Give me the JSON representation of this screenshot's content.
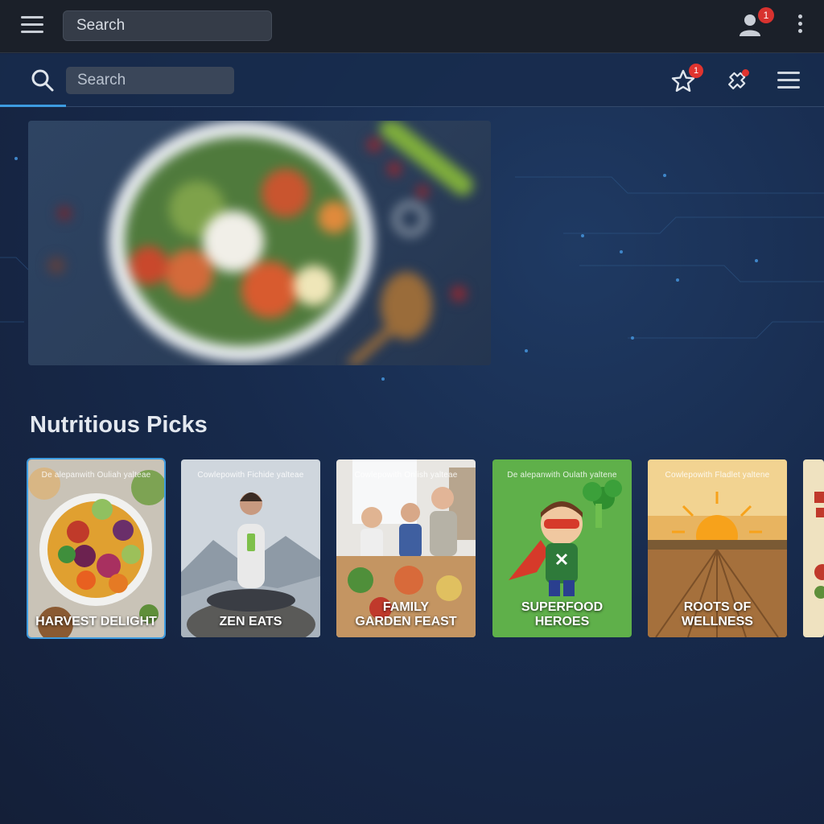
{
  "system_bar": {
    "search_text": "Search",
    "notification_count": "1",
    "icons": [
      "hamburger-icon",
      "user-icon",
      "kebab-icon"
    ]
  },
  "toolbar": {
    "search_placeholder": "Search",
    "favorites_count": "1",
    "icons": [
      "search-icon",
      "star-icon",
      "puzzle-icon",
      "menu-icon"
    ]
  },
  "section": {
    "title": "Nutritious Picks"
  },
  "cards": [
    {
      "title": "HARVEST DELIGHT",
      "tag": "De alepanwith Ouliah yalteae"
    },
    {
      "title": "ZEN EATS",
      "tag": "Cowlepowith Fichide yalteae"
    },
    {
      "title": "FAMILY\nGARDEN FEAST",
      "tag": "Cowlepowith Onlish yalteae"
    },
    {
      "title": "SUPERFOOD\nHEROES",
      "tag": "De alepanwith Oulath yaltene"
    },
    {
      "title": "ROOTS of\nWELLNESS",
      "tag": "Cowlepowith Fladlet yaltene"
    }
  ],
  "colors": {
    "accent": "#3d9be0",
    "badge": "#d8322f",
    "background": "#172a4c",
    "system_bar": "#1b2029"
  }
}
